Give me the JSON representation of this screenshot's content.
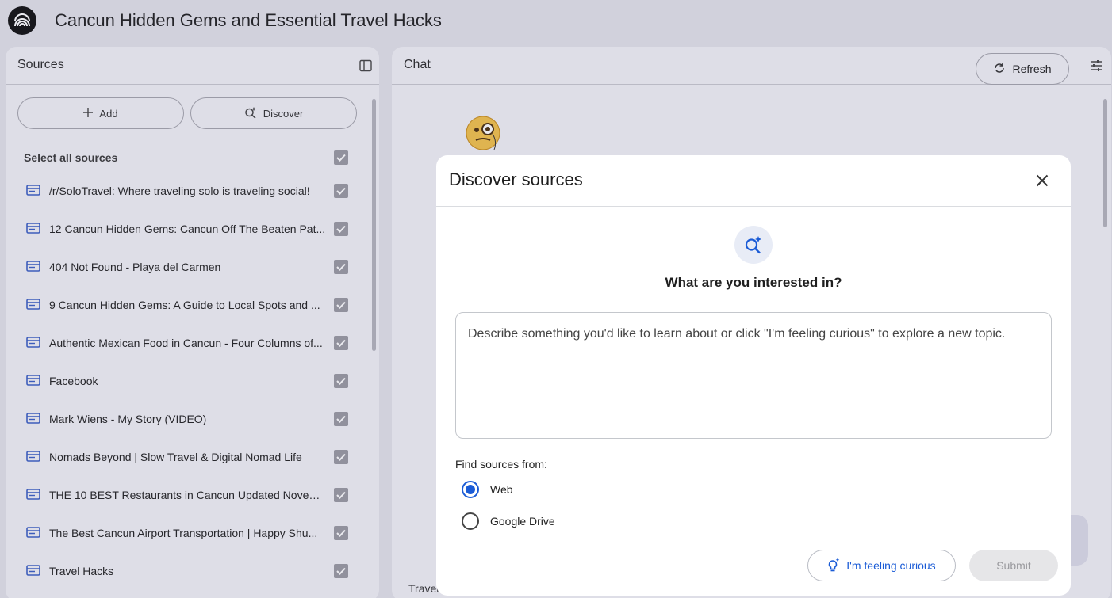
{
  "header": {
    "title": "Cancun Hidden Gems and Essential Travel Hacks",
    "logo_icon": "notebook-logo-icon"
  },
  "sources": {
    "title": "Sources",
    "add_label": "Add",
    "discover_label": "Discover",
    "select_all_label": "Select all sources",
    "items": [
      {
        "label": "/r/SoloTravel: Where traveling solo is traveling social!",
        "checked": true
      },
      {
        "label": "12 Cancun Hidden Gems: Cancun Off The Beaten Pat...",
        "checked": true
      },
      {
        "label": "404 Not Found - Playa del Carmen",
        "checked": true
      },
      {
        "label": "9 Cancun Hidden Gems: A Guide to Local Spots and ...",
        "checked": true
      },
      {
        "label": "Authentic Mexican Food in Cancun - Four Columns of...",
        "checked": true
      },
      {
        "label": "Facebook",
        "checked": true
      },
      {
        "label": "Mark Wiens - My Story (VIDEO)",
        "checked": true
      },
      {
        "label": "Nomads Beyond | Slow Travel & Digital Nomad Life",
        "checked": true
      },
      {
        "label": "THE 10 BEST Restaurants in Cancun Updated Novem...",
        "checked": true
      },
      {
        "label": "The Best Cancun Airport Transportation | Happy Shu...",
        "checked": true
      },
      {
        "label": "Travel Hacks",
        "checked": true
      }
    ]
  },
  "chat": {
    "title": "Chat",
    "refresh_label": "Refresh",
    "bottom_text": "Travel"
  },
  "dialog": {
    "title": "Discover sources",
    "question": "What are you interested in?",
    "placeholder": "Describe something you'd like to learn about or click \"I'm feeling curious\" to explore a new topic.",
    "find_label": "Find sources from:",
    "options": [
      {
        "label": "Web",
        "selected": true
      },
      {
        "label": "Google Drive",
        "selected": false
      }
    ],
    "curious_label": "I'm feeling curious",
    "submit_label": "Submit"
  },
  "colors": {
    "accent": "#1a5bd6",
    "source_icon": "#3b5fc4",
    "checkbox": "#9a9aa2"
  }
}
